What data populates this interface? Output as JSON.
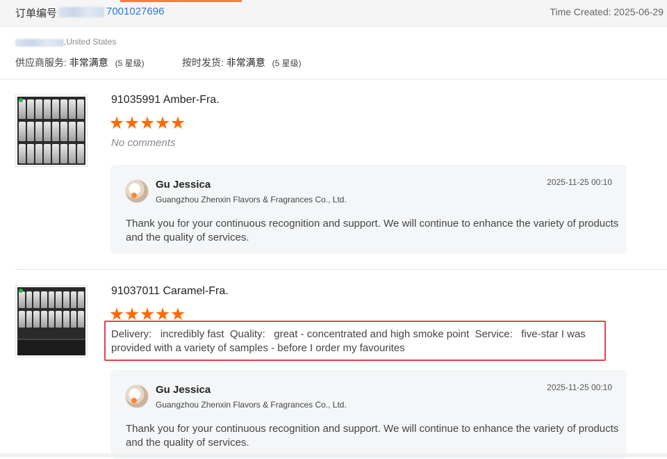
{
  "header": {
    "order_label": "订单编号",
    "order_number": "7001027696",
    "time_created": "Time Created: 2025-06-29"
  },
  "buyer": {
    "location": ",United States",
    "ratings": [
      {
        "label": "供应商服务:",
        "value": "非常满意",
        "level": "(5 星级)"
      },
      {
        "label": "按时发货:",
        "value": "非常满意",
        "level": "(5 星级)"
      }
    ]
  },
  "products": [
    {
      "title": "91035991 Amber-Fra.",
      "stars": 5,
      "comment": "No comments",
      "reply": {
        "name": "Gu Jessica",
        "company": "Guangzhou Zhenxin Flavors & Fragrances Co., Ltd.",
        "time": "2025-11-25 00:10",
        "text": "Thank you for your continuous recognition and support. We will continue to enhance the variety of products and the quality of services."
      }
    },
    {
      "title": "91037011 Caramel-Fra.",
      "stars": 5,
      "comment": "Delivery:   incredibly fast  Quality:   great - concentrated and high smoke point  Service:   five-star I was provided with a variety of samples - before I order my favourites",
      "reply": {
        "name": "Gu Jessica",
        "company": "Guangzhou Zhenxin Flavors & Fragrances Co., Ltd.",
        "time": "2025-11-25 00:10",
        "text": "Thank you for your continuous recognition and support. We will continue to enhance the variety of products and the quality of services."
      }
    }
  ],
  "colors": {
    "accent": "#ff6a00",
    "link": "#2a79d6",
    "highlight_border": "#e0434a"
  }
}
